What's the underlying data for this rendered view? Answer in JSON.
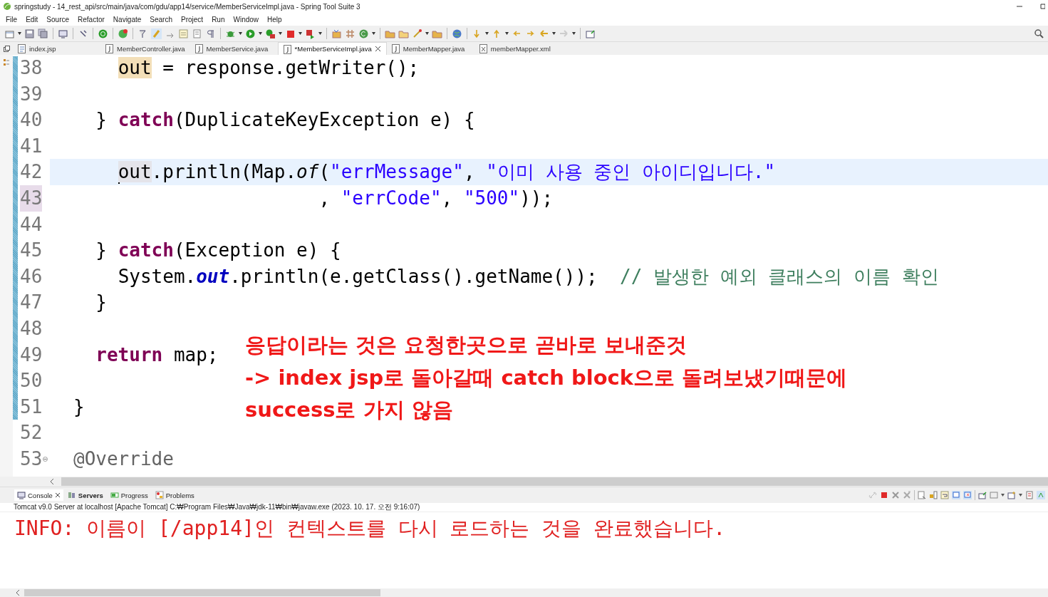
{
  "window": {
    "title": "springstudy - 14_rest_api/src/main/java/com/gdu/app14/service/MemberServiceImpl.java - Spring Tool Suite 3"
  },
  "menu": [
    "File",
    "Edit",
    "Source",
    "Refactor",
    "Navigate",
    "Search",
    "Project",
    "Run",
    "Window",
    "Help"
  ],
  "editor_tabs": [
    {
      "label": "index.jsp",
      "kind": "jsp",
      "selected": false
    },
    {
      "label": "MemberController.java",
      "kind": "java",
      "selected": false
    },
    {
      "label": "MemberService.java",
      "kind": "java",
      "selected": false
    },
    {
      "label": "*MemberServiceImpl.java",
      "kind": "java",
      "selected": true
    },
    {
      "label": "MemberMapper.java",
      "kind": "java",
      "selected": false
    },
    {
      "label": "memberMapper.xml",
      "kind": "xml",
      "selected": false
    }
  ],
  "code": {
    "lines": [
      {
        "number": "38",
        "current": false,
        "tokens": [
          {
            "text": "    out",
            "kind": "write-mark"
          },
          {
            "text": " = response.getWriter();",
            "kind": "plain"
          }
        ]
      },
      {
        "number": "39",
        "current": false
      },
      {
        "number": "40",
        "current": false,
        "tokens": [
          {
            "text": "  } ",
            "kind": "plain"
          },
          {
            "text": "catch",
            "kind": "keyword"
          },
          {
            "text": "(DuplicateKeyException e) {",
            "kind": "plain"
          }
        ]
      },
      {
        "number": "41",
        "current": false
      },
      {
        "number": "42",
        "current": true,
        "tokens": [
          {
            "text": "    out",
            "kind": "read-mark"
          },
          {
            "text": ".println(Map.",
            "kind": "plain"
          },
          {
            "text": "of",
            "kind": "italic"
          },
          {
            "text": "(",
            "kind": "plain"
          },
          {
            "text": "\"errMessage\"",
            "kind": "string"
          },
          {
            "text": ", ",
            "kind": "plain"
          },
          {
            "text": "\"이미 사용 중인 아이디입니다.\"",
            "kind": "string"
          }
        ]
      },
      {
        "number": "43",
        "current": false,
        "tokens": [
          {
            "text": "                      , ",
            "kind": "plain"
          },
          {
            "text": "\"errCode\"",
            "kind": "string"
          },
          {
            "text": ", ",
            "kind": "plain"
          },
          {
            "text": "\"500\"",
            "kind": "string"
          },
          {
            "text": "));",
            "kind": "plain"
          }
        ]
      },
      {
        "number": "44",
        "current": false
      },
      {
        "number": "45",
        "current": false,
        "tokens": [
          {
            "text": "  } ",
            "kind": "plain"
          },
          {
            "text": "catch",
            "kind": "keyword"
          },
          {
            "text": "(Exception e) {",
            "kind": "plain"
          }
        ]
      },
      {
        "number": "46",
        "current": false,
        "tokens": [
          {
            "text": "    System.",
            "kind": "plain"
          },
          {
            "text": "out",
            "kind": "field"
          },
          {
            "text": ".println(e.getClass().getName());  ",
            "kind": "plain"
          },
          {
            "text": "// 발생한 예외 클래스의 이름 확인",
            "kind": "comment"
          }
        ]
      },
      {
        "number": "47",
        "current": false,
        "tokens": [
          {
            "text": "  }",
            "kind": "plain"
          }
        ]
      },
      {
        "number": "48",
        "current": false
      },
      {
        "number": "49",
        "current": false,
        "tokens": [
          {
            "text": "  return",
            "kind": "keyword"
          },
          {
            "text": " map;",
            "kind": "plain"
          }
        ]
      },
      {
        "number": "50",
        "current": false
      },
      {
        "number": "51",
        "current": false,
        "tokens": [
          {
            "text": "}",
            "kind": "plain"
          }
        ]
      },
      {
        "number": "52",
        "current": false
      },
      {
        "number": "53",
        "current": false,
        "folded": false,
        "tokens": [
          {
            "text": "@Override",
            "kind": "annotation"
          }
        ]
      }
    ]
  },
  "annotation": [
    "응답이라는 것은 요청한곳으로 곧바로 보내준것",
    "-> index jsp로 돌아갈때 catch block으로 돌려보냈기때문에",
    "success로 가지 않음"
  ],
  "console": {
    "tabs": [
      {
        "label": "Console",
        "kind": "console",
        "selected": true,
        "bold": false
      },
      {
        "label": "Servers",
        "kind": "servers",
        "selected": false,
        "bold": true
      },
      {
        "label": "Progress",
        "kind": "progress",
        "selected": false,
        "bold": false
      },
      {
        "label": "Problems",
        "kind": "problems",
        "selected": false,
        "bold": false
      }
    ],
    "description": "Tomcat v9.0 Server at localhost [Apache Tomcat] C:₩Program Files₩Java₩jdk-11₩bin₩javaw.exe  (2023. 10. 17. 오전 9:16:07)",
    "output": "INFO: 이름이 [/app14]인 컨텍스트를 다시 로드하는 것을 완료했습니다."
  }
}
